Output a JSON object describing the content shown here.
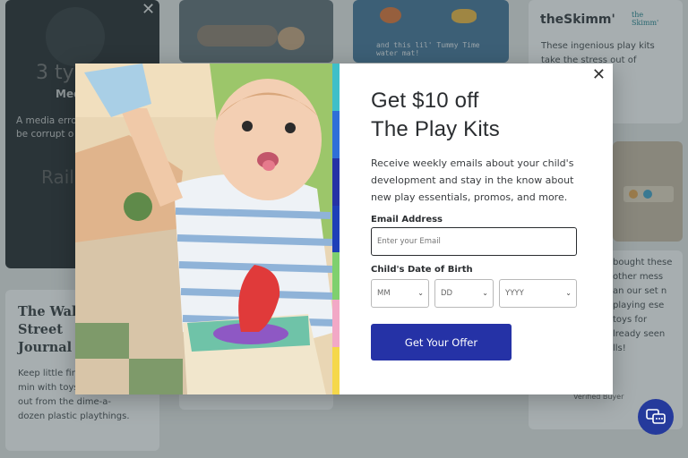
{
  "background": {
    "media_card": {
      "big_text": "3 ty sensor",
      "media_title": "Medi",
      "error_text": "A media error to be aborted. be corrupt o does not sup",
      "faded_text": "Rail"
    },
    "wsj_card": {
      "title": "The Wall Street Journal",
      "text": "Keep little fin growing min with toys that stand out from the dime-a-dozen plastic playthings."
    },
    "skimm_card": {
      "logo": "theSkimm'",
      "mini_logo": "the Skimm'",
      "text": "These ingenious play kits take the stress out of propriate ey're"
    },
    "review_card": {
      "text": "bought these other mess an our set n playing ese toys for lready seen lls!",
      "verified": "Verified Buyer"
    },
    "placemat_text": "and this lil' Tummy Time water mat!"
  },
  "modal": {
    "title_line1": "Get $10 off",
    "title_line2": "The Play Kits",
    "description": "Receive weekly emails about your child's development and stay in the know about new play essentials, promos, and more.",
    "email_label": "Email Address",
    "email_placeholder": "Enter your Email",
    "email_value": "",
    "dob_label": "Child's Date of Birth",
    "month_value": "MM",
    "day_value": "DD",
    "year_value": "YYYY",
    "cta_label": "Get Your Offer",
    "close_symbol": "✕"
  },
  "colors": {
    "accent": "#2532a6",
    "strip": [
      "#3fbfc9",
      "#2f6fd8",
      "#2532a6",
      "#1e3fb8",
      "#7fd06e",
      "#f2a8c6",
      "#f5d84a"
    ]
  },
  "icons": {
    "close": "close-icon",
    "caret": "chevron-down-icon",
    "chat": "chat-icon"
  }
}
